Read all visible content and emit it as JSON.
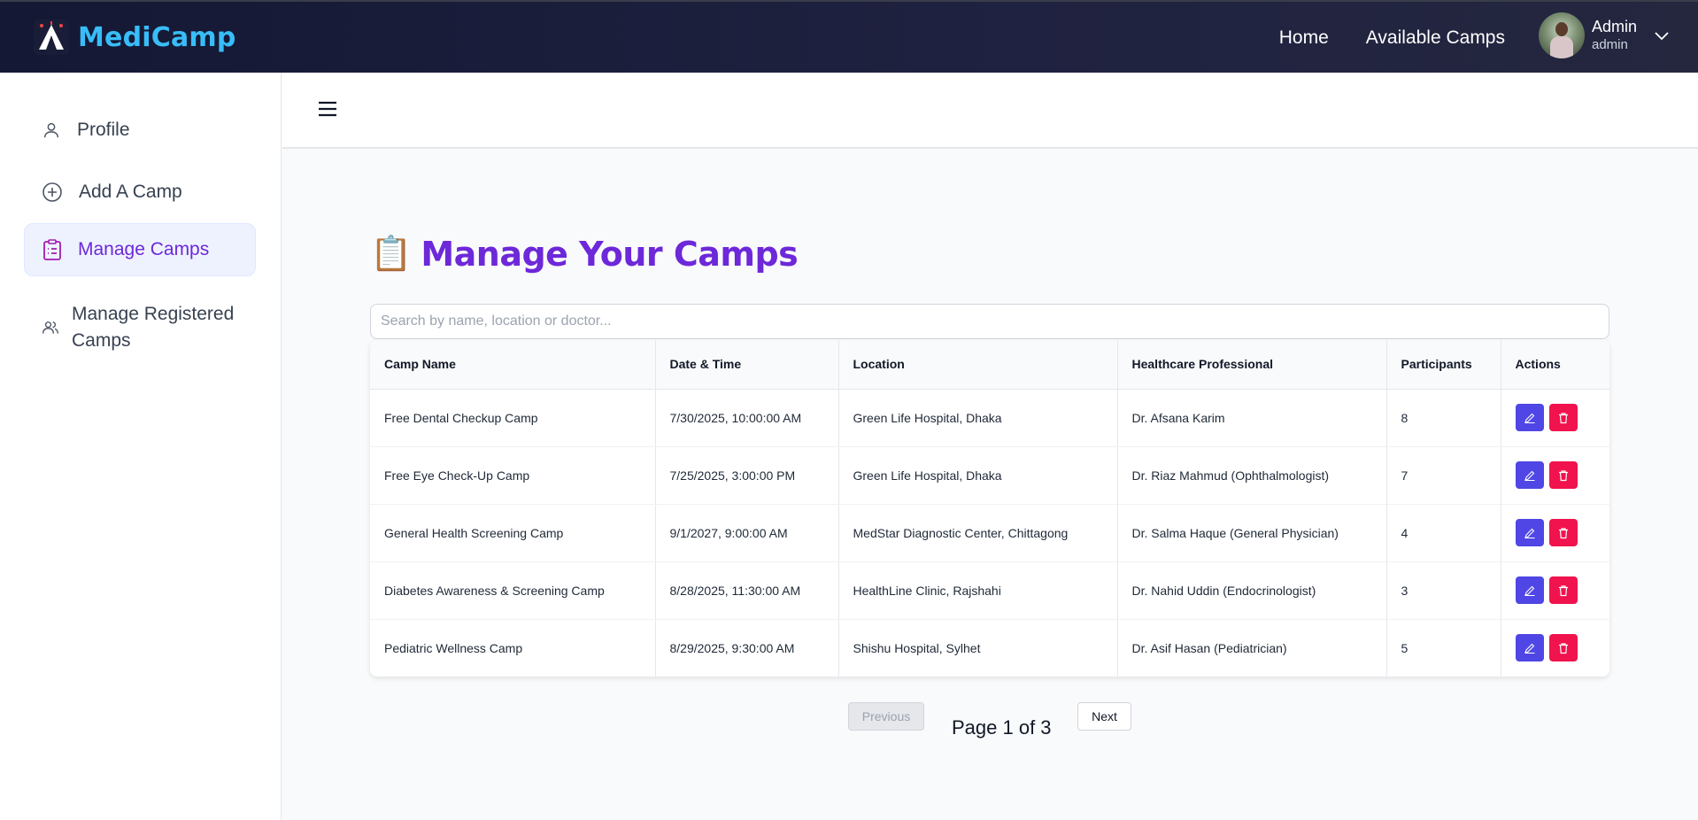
{
  "brand": {
    "name": "MediCamp",
    "logo_icon": "camp-tent-icon"
  },
  "nav": {
    "links": [
      "Home",
      "Available Camps"
    ]
  },
  "user": {
    "name": "Admin",
    "role": "admin"
  },
  "sidebar": {
    "items": [
      {
        "label": "Profile",
        "icon": "user-icon",
        "active": false
      },
      {
        "label": "Add A Camp",
        "icon": "plus-circle-icon",
        "active": false
      },
      {
        "label": "Manage Camps",
        "icon": "clipboard-list-icon",
        "active": true
      },
      {
        "label": "Manage Registered Camps",
        "icon": "users-icon",
        "active": false
      }
    ]
  },
  "main": {
    "title_emoji": "📋",
    "title": "Manage Your Camps",
    "search_placeholder": "Search by name, location or doctor...",
    "search_value": ""
  },
  "table": {
    "columns": [
      "Camp Name",
      "Date & Time",
      "Location",
      "Healthcare Professional",
      "Participants",
      "Actions"
    ],
    "rows": [
      {
        "name": "Free Dental Checkup Camp",
        "datetime": "7/30/2025, 10:00:00 AM",
        "location": "Green Life Hospital, Dhaka",
        "professional": "Dr. Afsana Karim",
        "participants": "8"
      },
      {
        "name": "Free Eye Check-Up Camp",
        "datetime": "7/25/2025, 3:00:00 PM",
        "location": "Green Life Hospital, Dhaka",
        "professional": "Dr. Riaz Mahmud (Ophthalmologist)",
        "participants": "7"
      },
      {
        "name": "General Health Screening Camp",
        "datetime": "9/1/2027, 9:00:00 AM",
        "location": "MedStar Diagnostic Center, Chittagong",
        "professional": "Dr. Salma Haque (General Physician)",
        "participants": "4"
      },
      {
        "name": "Diabetes Awareness & Screening Camp",
        "datetime": "8/28/2025, 11:30:00 AM",
        "location": "HealthLine Clinic, Rajshahi",
        "professional": "Dr. Nahid Uddin (Endocrinologist)",
        "participants": "3"
      },
      {
        "name": "Pediatric Wellness Camp",
        "datetime": "8/29/2025, 9:30:00 AM",
        "location": "Shishu Hospital, Sylhet",
        "professional": "Dr. Asif Hasan (Pediatrician)",
        "participants": "5"
      }
    ],
    "action_icons": [
      "edit-pencil-icon",
      "trash-icon"
    ]
  },
  "pagination": {
    "previous_label": "Previous",
    "next_label": "Next",
    "page_text": "Page 1 of 3"
  },
  "colors": {
    "accent": "#6d28d9",
    "brand": "#38bdf8",
    "edit": "#4f46e5",
    "delete": "#f0134d",
    "navbar": "#1a1d38"
  }
}
